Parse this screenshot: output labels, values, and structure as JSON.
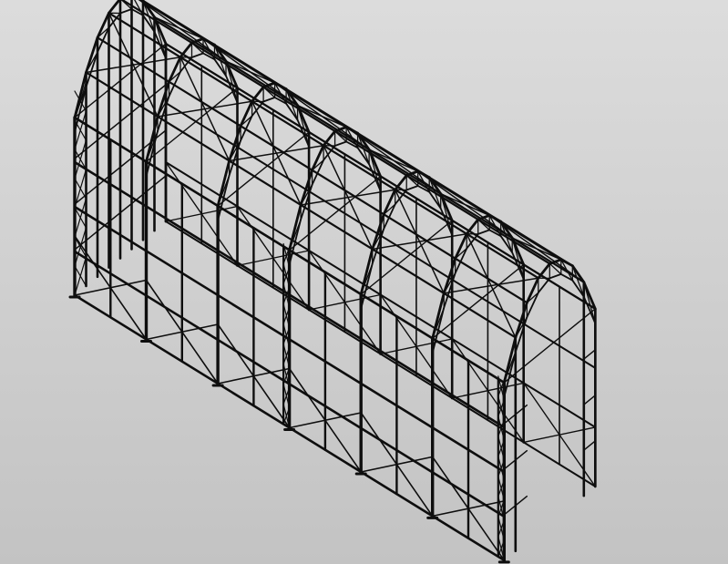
{
  "scene": {
    "background_top": "#dcdcdc",
    "background_bottom": "#c3c3c3",
    "stroke_color": "#0e0e0e"
  }
}
